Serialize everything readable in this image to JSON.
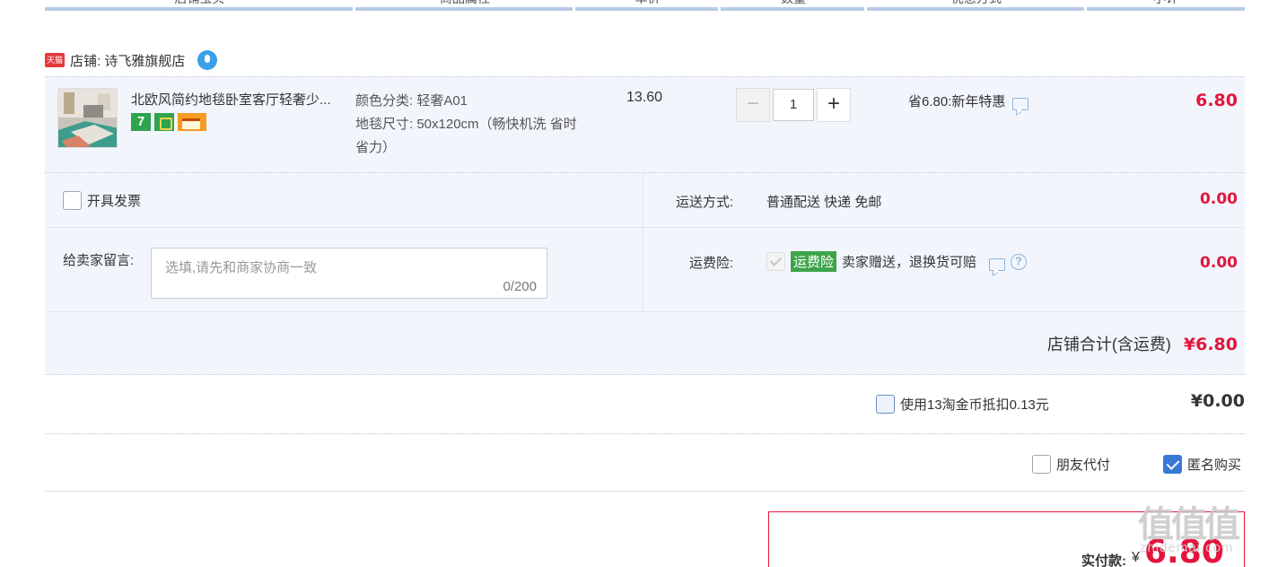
{
  "header": {
    "columns": [
      "店铺宝贝",
      "商品属性",
      "单价",
      "数量",
      "优惠方式",
      "小计"
    ]
  },
  "shop": {
    "badge": "天猫",
    "label": "店铺: 诗飞雅旗舰店"
  },
  "item": {
    "title": "北欧风简约地毯卧室客厅轻奢少...",
    "tags": [
      "7",
      "icon",
      "icon"
    ],
    "props": [
      "颜色分类: 轻奢A01",
      "地毯尺寸: 50x120cm（畅快机洗 省时省力）"
    ],
    "price": "13.60",
    "quantity": "1",
    "qty_minus": "−",
    "qty_plus": "+",
    "discount": "省6.80:新年特惠",
    "subtotal": "6.80"
  },
  "options": {
    "invoice_label": "开具发票",
    "shipping_label": "运送方式:",
    "shipping_value": "普通配送 快递 免邮",
    "shipping_fee": "0.00",
    "message_label": "给卖家留言:",
    "message_placeholder": "选填,请先和商家协商一致",
    "message_count": "0/200",
    "insurance_label": "运费险:",
    "insurance_badge": "运费险",
    "insurance_desc": "卖家赠送，退换货可赔",
    "insurance_help": "?",
    "insurance_fee": "0.00",
    "shop_total_label": "店铺合计(含运费)",
    "shop_total_value": "¥6.80"
  },
  "coins": {
    "label": "使用13淘金币抵扣0.13元",
    "value": "¥0.00"
  },
  "pay_options": {
    "friend_pay": "朋友代付",
    "anonymous": "匿名购买",
    "anonymous_checked": true
  },
  "payment": {
    "label": "实付款:",
    "currency": "¥",
    "amount": "6.80"
  },
  "watermark": {
    "text": "zhidemai.com"
  },
  "colors": {
    "price_red": "#e4143c",
    "panel_bg": "#f2f6fc",
    "accent_blue": "#3a78d6",
    "insurance_green": "#3ea44c"
  }
}
